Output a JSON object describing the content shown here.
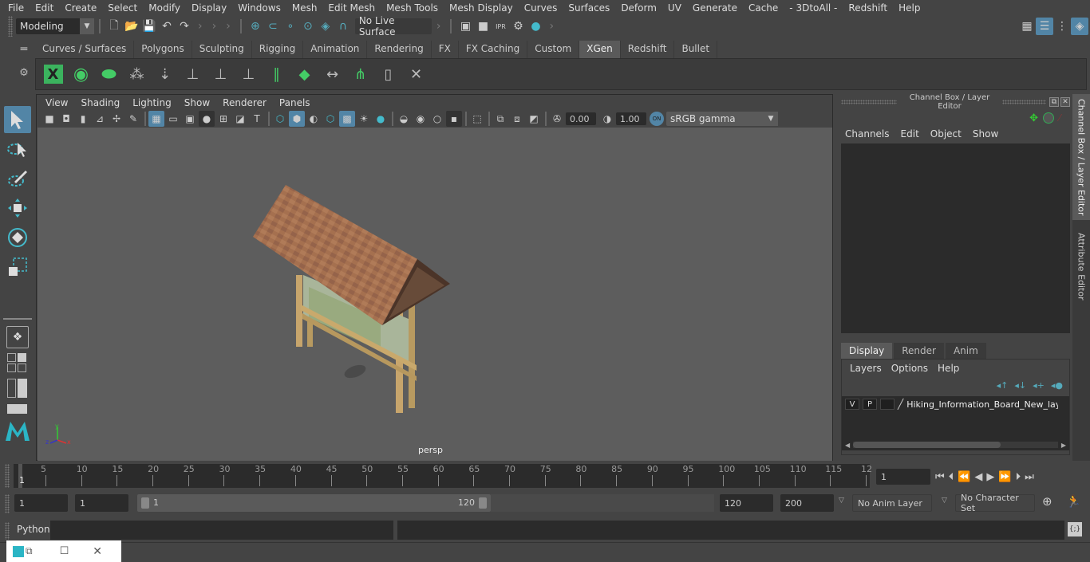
{
  "menubar": {
    "items": [
      "File",
      "Edit",
      "Create",
      "Select",
      "Modify",
      "Display",
      "Windows",
      "Mesh",
      "Edit Mesh",
      "Mesh Tools",
      "Mesh Display",
      "Curves",
      "Surfaces",
      "Deform",
      "UV",
      "Generate",
      "Cache",
      "- 3DtoAll -",
      "Redshift",
      "Help"
    ]
  },
  "statusline": {
    "mode": "Modeling",
    "live_surface": "No Live Surface"
  },
  "shelf": {
    "tabs": [
      "Curves / Surfaces",
      "Polygons",
      "Sculpting",
      "Rigging",
      "Animation",
      "Rendering",
      "FX",
      "FX Caching",
      "Custom",
      "XGen",
      "Redshift",
      "Bullet"
    ],
    "active_tab": "XGen"
  },
  "viewport": {
    "menu": [
      "View",
      "Shading",
      "Lighting",
      "Show",
      "Renderer",
      "Panels"
    ],
    "exposure": "0.00",
    "gamma": "1.00",
    "color_toggle": "ON",
    "color_space": "sRGB gamma",
    "camera_label": "persp",
    "axis": {
      "x": "x",
      "y": "y",
      "z": "z"
    }
  },
  "channel_box": {
    "title": "Channel Box / Layer Editor",
    "menu": [
      "Channels",
      "Edit",
      "Object",
      "Show"
    ],
    "layer_tabs": [
      "Display",
      "Render",
      "Anim"
    ],
    "active_layer_tab": "Display",
    "layer_menu": [
      "Layers",
      "Options",
      "Help"
    ],
    "layers": [
      {
        "v": "V",
        "p": "P",
        "name": "Hiking_Information_Board_New_laye"
      }
    ]
  },
  "side_tabs": [
    "Channel Box / Layer Editor",
    "Attribute Editor"
  ],
  "timeline": {
    "ticks": [
      "5",
      "10",
      "15",
      "20",
      "25",
      "30",
      "35",
      "40",
      "45",
      "50",
      "55",
      "60",
      "65",
      "70",
      "75",
      "80",
      "85",
      "90",
      "95",
      "100",
      "105",
      "110",
      "115",
      "12"
    ],
    "current_marker": "1",
    "current_frame": "1"
  },
  "range": {
    "start": "1",
    "anim_start": "1",
    "slider_start": "1",
    "slider_end": "120",
    "end": "120",
    "anim_end": "200",
    "anim_layer": "No Anim Layer",
    "character_set": "No Character Set"
  },
  "command_line": {
    "label": "Python"
  }
}
